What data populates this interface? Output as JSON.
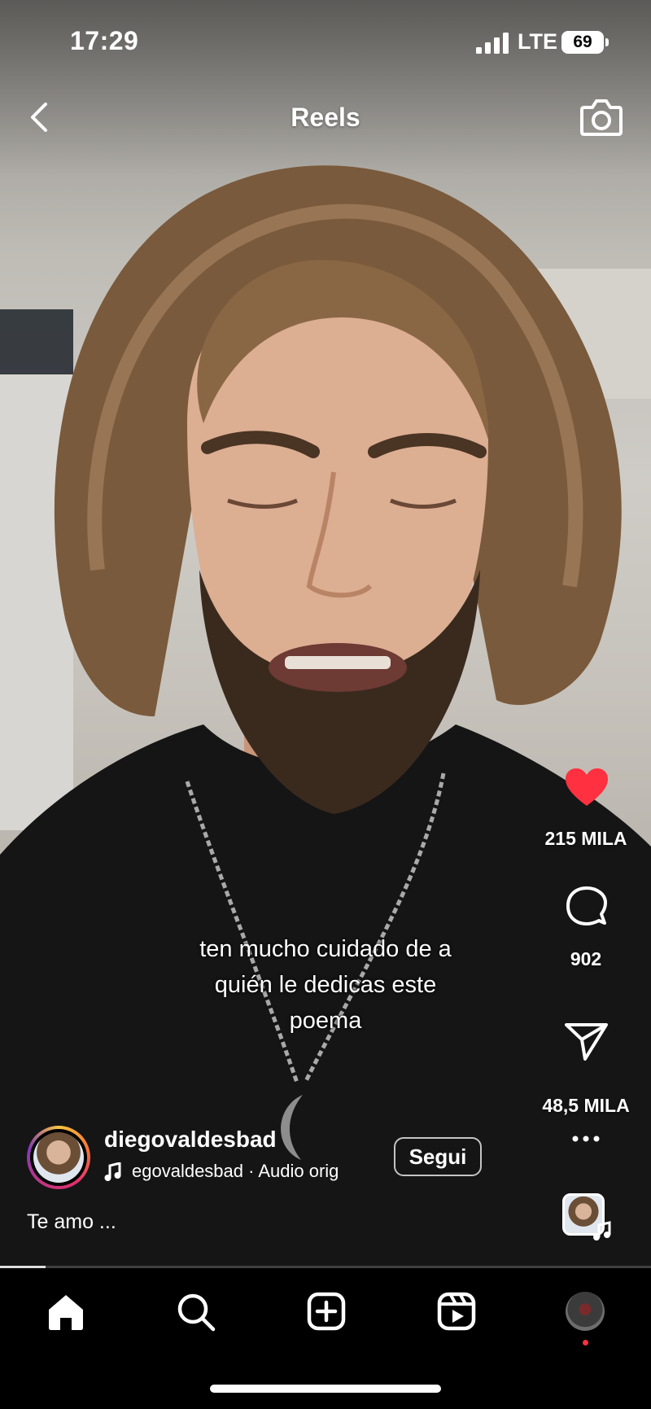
{
  "status_bar": {
    "time": "17:29",
    "network": "LTE",
    "battery": "69"
  },
  "header": {
    "title": "Reels"
  },
  "actions": {
    "likes": "215 MILA",
    "comments": "902",
    "shares": "48,5 MILA"
  },
  "overlay_text": [
    "ten mucho cuidado de a",
    "quién le dedicas este",
    "poema"
  ],
  "author": {
    "username": "diegovaldesbad",
    "audio": "egovaldesbad · Audio orig",
    "follow_label": "Segui"
  },
  "caption": "Te amo ...",
  "progress": 0.07,
  "nav": {
    "items": [
      "home-icon",
      "search-icon",
      "create-icon",
      "reels-icon",
      "profile-avatar"
    ],
    "active": "home-icon"
  },
  "colors": {
    "like": "#ff3040",
    "text": "#ffffff",
    "nav_bg": "#000000"
  }
}
